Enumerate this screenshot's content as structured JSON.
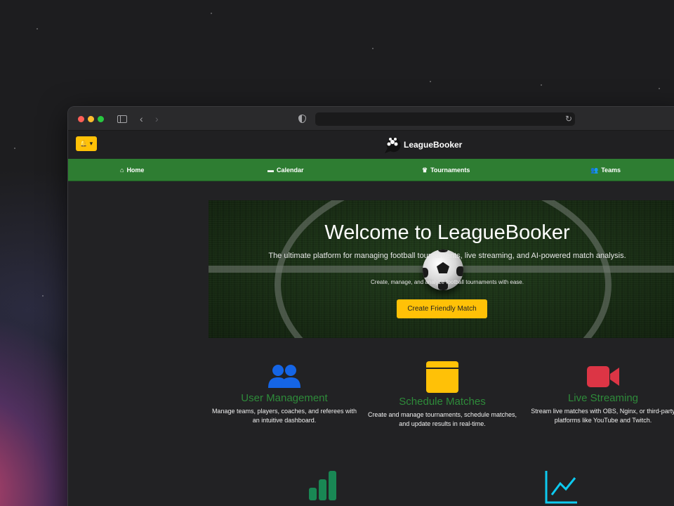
{
  "browser": {
    "url": ""
  },
  "header": {
    "logo_text": "LeagueBooker",
    "notification_label": "🔔 ▾"
  },
  "nav": {
    "items": [
      {
        "label": "Home",
        "icon": "house-icon",
        "glyph": "⌂"
      },
      {
        "label": "Calendar",
        "icon": "calendar-icon",
        "glyph": "▬"
      },
      {
        "label": "Tournaments",
        "icon": "trophy-icon",
        "glyph": "♛"
      },
      {
        "label": "Teams",
        "icon": "users-icon",
        "glyph": "👥"
      }
    ]
  },
  "hero": {
    "title": "Welcome to LeagueBooker",
    "subtitle": "The ultimate platform for managing football tournaments, live streaming, and AI-powered match analysis.",
    "tagline": "Create, manage, and analyze football tournaments with ease.",
    "cta_label": "Create Friendly Match"
  },
  "features": [
    {
      "title": "User Management",
      "description_line1": "Manage teams, players, coaches, and referees with",
      "description_line2": "an intuitive dashboard.",
      "icon": "users-icon",
      "color": "#1565e6"
    },
    {
      "title": "Schedule Matches",
      "description_line1": "Create and manage tournaments, schedule matches,",
      "description_line2": "and update results in real-time.",
      "icon": "calendar-icon",
      "color": "#ffc107"
    },
    {
      "title": "Live Streaming",
      "description_line1": "Stream live matches with OBS, Nginx, or third-party",
      "description_line2": "platforms like YouTube and Twitch.",
      "icon": "video-camera-icon",
      "color": "#dc3545"
    },
    {
      "icon": "bar-chart-icon",
      "color": "#198754"
    },
    {
      "icon": "line-chart-icon",
      "color": "#0dcaf0"
    }
  ],
  "colors": {
    "nav_green": "#2e7d32",
    "accent_yellow": "#ffc107",
    "feature_title_green": "#2e8b3a"
  }
}
